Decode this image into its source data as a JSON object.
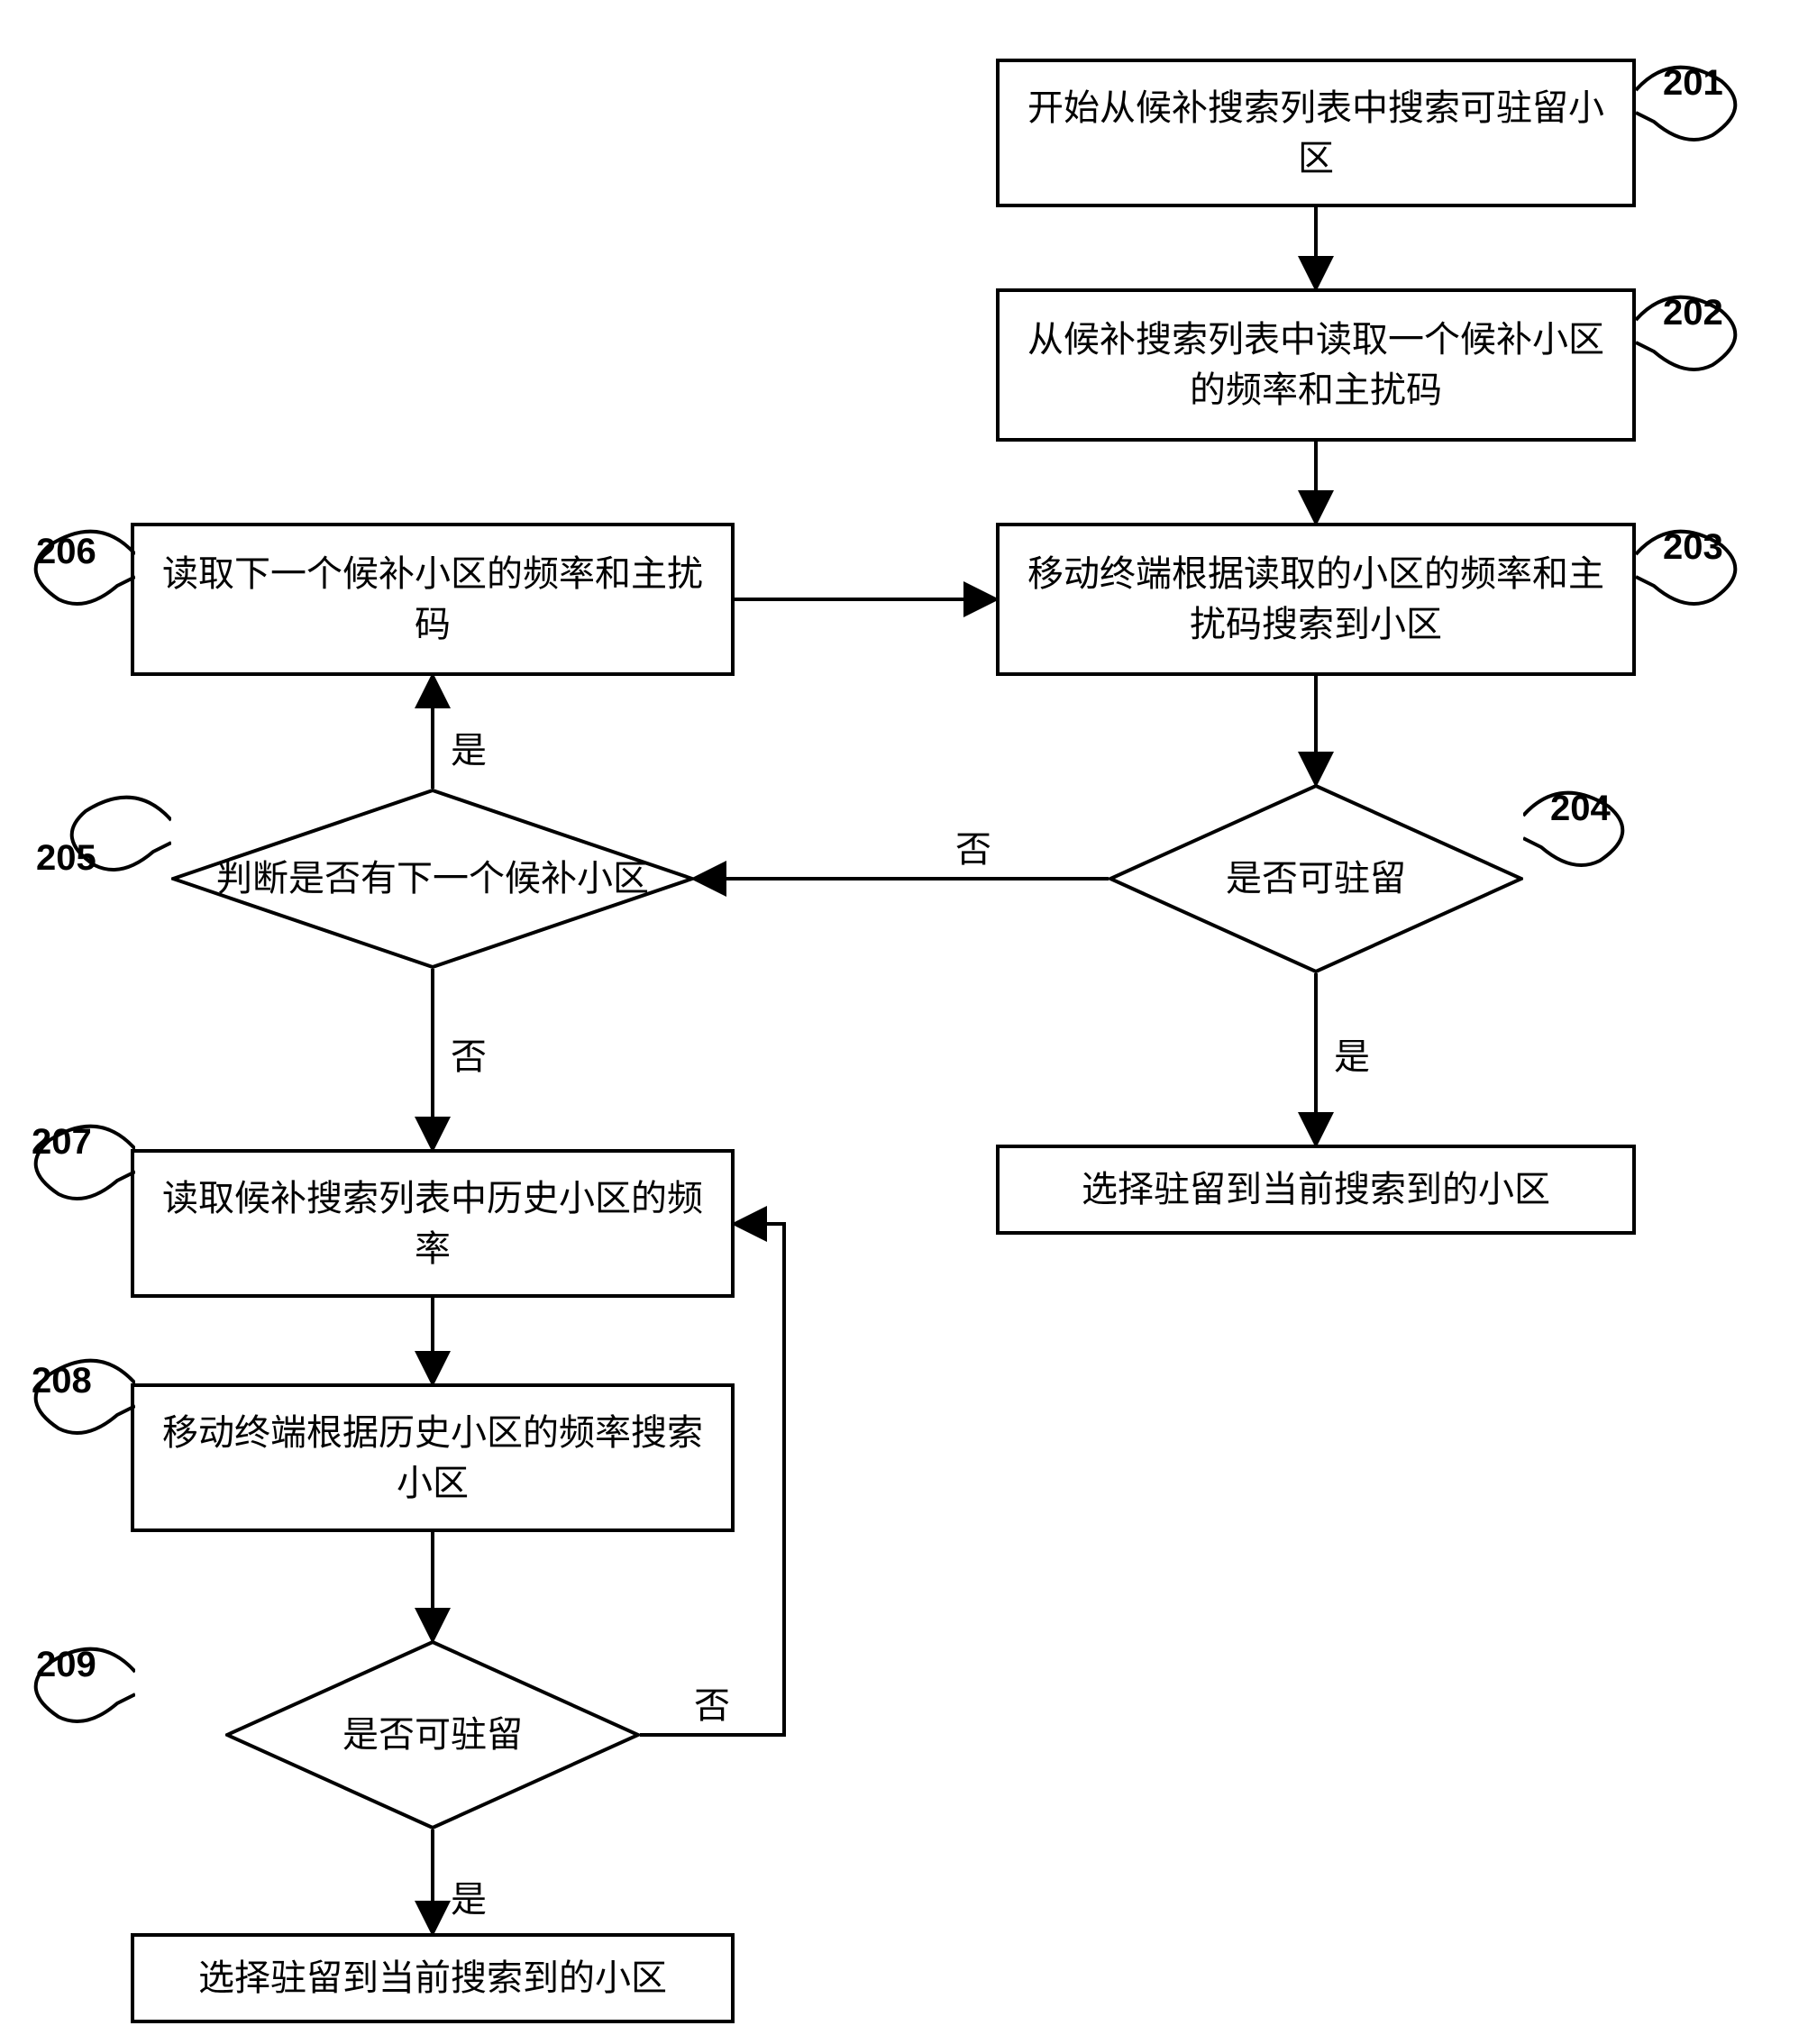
{
  "chart_data": {
    "type": "flowchart",
    "nodes": [
      {
        "id": "201",
        "shape": "rect",
        "text": "开始从候补搜索列表中搜索可驻留小区"
      },
      {
        "id": "202",
        "shape": "rect",
        "text": "从候补搜索列表中读取一个候补小区的频率和主扰码"
      },
      {
        "id": "203",
        "shape": "rect",
        "text": "移动终端根据读取的小区的频率和主扰码搜索到小区"
      },
      {
        "id": "204",
        "shape": "diamond",
        "text": "是否可驻留"
      },
      {
        "id": "204yes",
        "shape": "rect",
        "text": "选择驻留到当前搜索到的小区"
      },
      {
        "id": "205",
        "shape": "diamond",
        "text": "判断是否有下一个候补小区"
      },
      {
        "id": "206",
        "shape": "rect",
        "text": "读取下一个候补小区的频率和主扰码"
      },
      {
        "id": "207",
        "shape": "rect",
        "text": "读取候补搜索列表中历史小区的频率"
      },
      {
        "id": "208",
        "shape": "rect",
        "text": "移动终端根据历史小区的频率搜索小区"
      },
      {
        "id": "209",
        "shape": "diamond",
        "text": "是否可驻留"
      },
      {
        "id": "209yes",
        "shape": "rect",
        "text": "选择驻留到当前搜索到的小区"
      }
    ],
    "edges": [
      {
        "from": "201",
        "to": "202"
      },
      {
        "from": "202",
        "to": "203"
      },
      {
        "from": "203",
        "to": "204"
      },
      {
        "from": "204",
        "to": "204yes",
        "label": "是"
      },
      {
        "from": "204",
        "to": "205",
        "label": "否"
      },
      {
        "from": "205",
        "to": "206",
        "label": "是"
      },
      {
        "from": "205",
        "to": "207",
        "label": "否"
      },
      {
        "from": "206",
        "to": "203"
      },
      {
        "from": "207",
        "to": "208"
      },
      {
        "from": "208",
        "to": "209"
      },
      {
        "from": "209",
        "to": "209yes",
        "label": "是"
      },
      {
        "from": "209",
        "to": "207",
        "label": "否"
      }
    ],
    "labels": {
      "n201": "201",
      "n202": "202",
      "n203": "203",
      "n204": "204",
      "n205": "205",
      "n206": "206",
      "n207": "207",
      "n208": "208",
      "n209": "209"
    },
    "edgeText": {
      "yes": "是",
      "no": "否"
    }
  }
}
